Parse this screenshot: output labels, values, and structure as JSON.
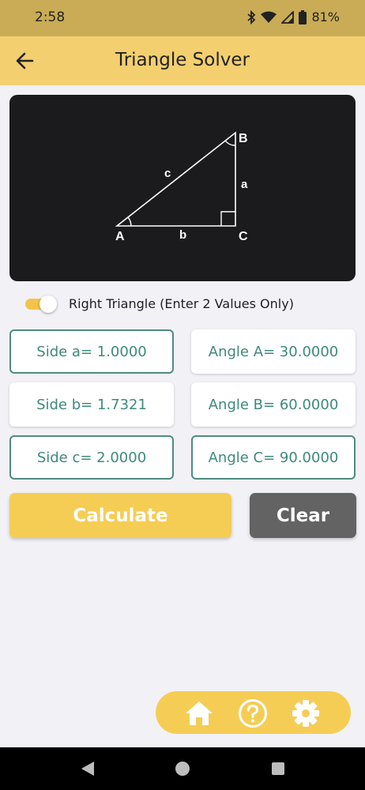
{
  "status_bar": {
    "time": "2:58",
    "battery": "81%"
  },
  "app_bar": {
    "title": "Triangle Solver"
  },
  "diagram": {
    "vertex_a": "A",
    "vertex_b": "B",
    "vertex_c": "C",
    "side_a": "a",
    "side_b": "b",
    "side_c": "c"
  },
  "mode_toggle": {
    "label": "Right Triangle (Enter 2 Values Only)",
    "on": true
  },
  "fields": {
    "side_a": "Side a= 1.0000",
    "side_b": "Side b= 1.7321",
    "side_c": "Side c= 2.0000",
    "angle_a": "Angle A= 30.0000",
    "angle_b": "Angle B= 60.0000",
    "angle_c": "Angle C= 90.0000"
  },
  "actions": {
    "calculate": "Calculate",
    "clear": "Clear"
  },
  "bottom_nav": [
    "home-icon",
    "help-icon",
    "settings-icon"
  ],
  "colors": {
    "accent": "#f5cd55",
    "app_bar": "#f3cf6f",
    "field_text": "#3d8a7c",
    "field_border": "#4d8c80",
    "clear_button": "#636363"
  }
}
